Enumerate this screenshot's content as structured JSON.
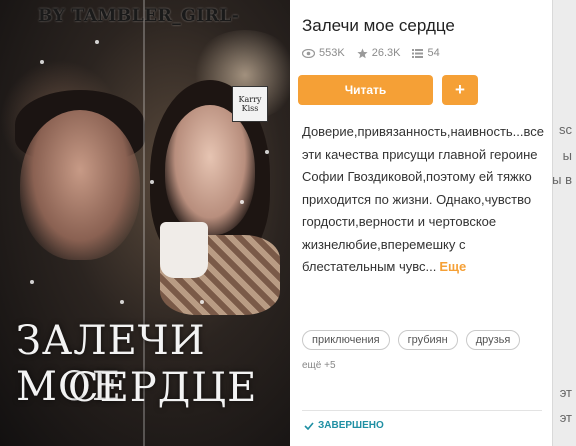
{
  "cover": {
    "byline": "BY TAMBLER_GIRL-",
    "badge_text": "Karry Kiss",
    "title_line1": "ЗАЛЕЧИ МОЕ",
    "title_line2": "СЕРДЦЕ"
  },
  "book": {
    "title": "Залечи мое сердце",
    "stats": {
      "views": "553K",
      "rating": "26.3K",
      "chapters": "54"
    },
    "read_button": "Читать",
    "add_button": "+",
    "description": "Доверие,привязанность,наивность...все эти качества присущи главной героине Софии Гвоздиковой,поэтому ей тяжко приходится по жизни. Однако,чувство гордости,верности и чертовское жизнелюбие,вперемешку с блестательным чувс...",
    "more_link": "Еще",
    "tags": [
      "приключения",
      "грубиян",
      "друзья"
    ],
    "more_tags": "ещё +5",
    "status": "ЗАВЕРШЕНО"
  },
  "background_fragments": [
    "sc",
    "ы",
    "ы в",
    "эт",
    "эт"
  ],
  "colors": {
    "accent": "#f5a036",
    "status": "#1f8fa3"
  },
  "icons": {
    "views": "eye-icon",
    "rating": "star-icon",
    "chapters": "list-icon",
    "status": "check-icon"
  }
}
